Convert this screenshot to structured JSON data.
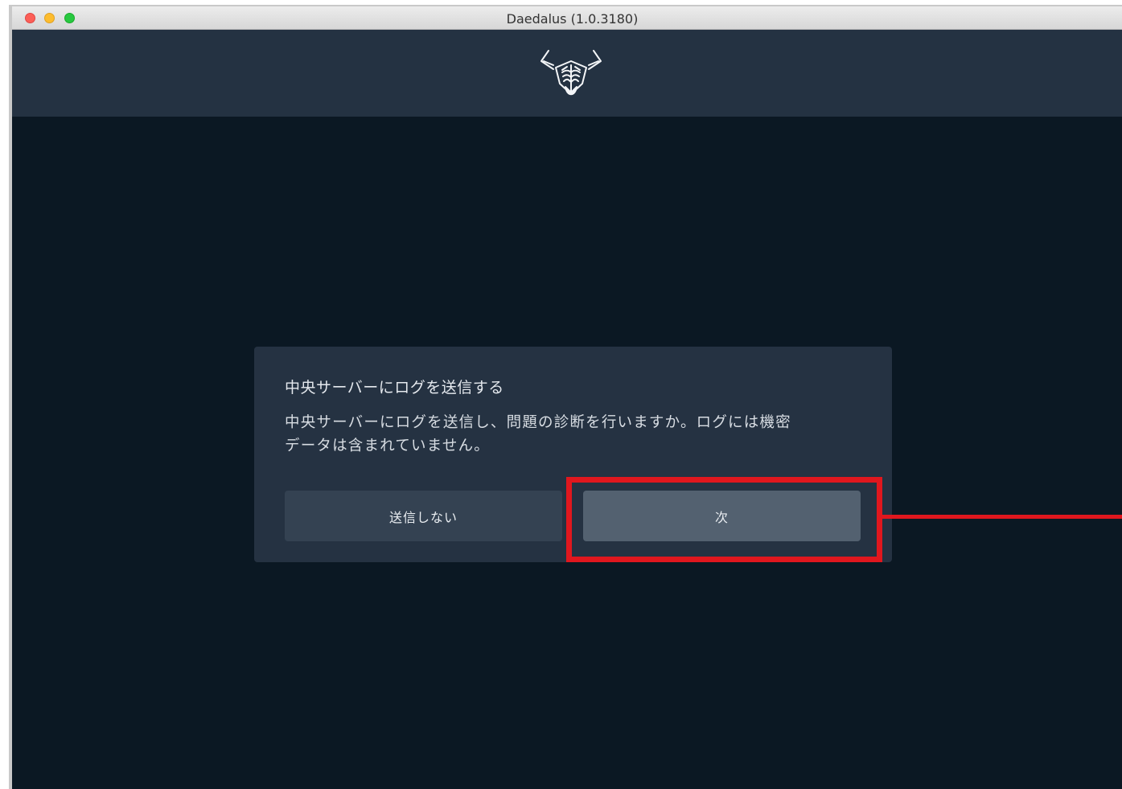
{
  "window": {
    "title": "Daedalus (1.0.3180)",
    "controls": [
      "close",
      "minimize",
      "maximize"
    ]
  },
  "header": {
    "logo_icon": "daedalus-bull-logo-icon"
  },
  "dialog": {
    "title": "中央サーバーにログを送信する",
    "message_line1": "中央サーバーにログを送信し、問題の診断を行いますか。ログには機密",
    "message_line2": "データは含まれていません。",
    "decline_label": "送信しない",
    "next_label": "次"
  },
  "annotation": {
    "highlight_color": "#e0171e",
    "target": "next-button"
  },
  "colors": {
    "header_bg": "#243242",
    "content_bg": "#0b1823",
    "dialog_bg": "#253242",
    "decline_button_bg": "#344252",
    "next_button_bg": "#536170",
    "text": "#e5e9ee"
  }
}
